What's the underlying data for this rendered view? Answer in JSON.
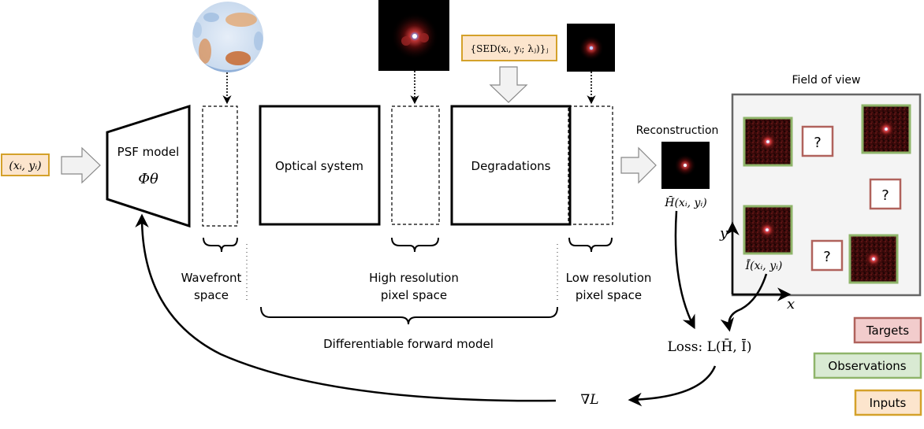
{
  "inputs": {
    "position": "(xᵢ, yᵢ)",
    "sed": "{SED(xᵢ, yᵢ; λⱼ)}ⱼ"
  },
  "blocks": {
    "psf_model": {
      "label": "PSF model",
      "symbol": "Φθ"
    },
    "optical_system": {
      "label": "Optical system"
    },
    "degradations": {
      "label": "Degradations"
    }
  },
  "spaces": {
    "wavefront": [
      "Wavefront",
      "space"
    ],
    "high_res": [
      "High resolution",
      "pixel space"
    ],
    "low_res": [
      "Low resolution",
      "pixel space"
    ],
    "forward_model": "Differentiable forward model"
  },
  "reconstruction": {
    "title": "Reconstruction",
    "formula": "H̄(xᵢ, yᵢ)"
  },
  "field_of_view": {
    "title": "Field of view",
    "observation_label": "Ī(xᵢ, yᵢ)",
    "target_mark": "?",
    "axis_x": "x",
    "axis_y": "y",
    "observation_count": 4,
    "target_count": 3
  },
  "loss": {
    "label": "Loss: L(H̄, Ī)",
    "gradient": "∇L"
  },
  "legend": {
    "targets": "Targets",
    "observations": "Observations",
    "inputs": "Inputs"
  },
  "colors": {
    "target_border": "#b0625c",
    "target_fill": "#f2cccc",
    "observation_border": "#8fb56a",
    "observation_fill": "#d9ead3",
    "input_border": "#d4a12a",
    "input_fill": "#fce5cd",
    "fov_border": "#666666",
    "fov_fill": "#f4f4f4",
    "arrow_fill": "#f2f2f2",
    "arrow_stroke": "#888888",
    "psf_background": "#000000",
    "noise_background": "#3a0a0a"
  }
}
